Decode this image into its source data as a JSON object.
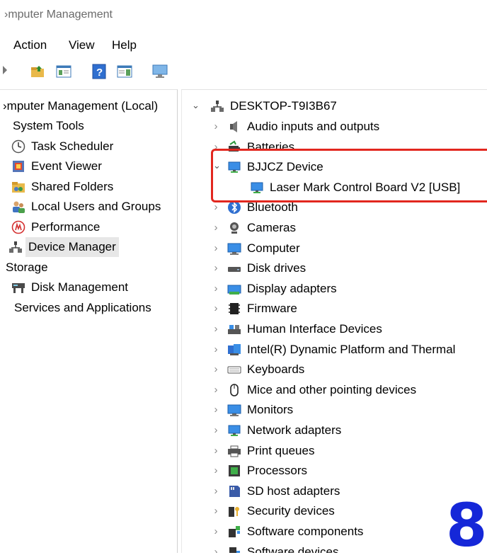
{
  "window": {
    "title": "›mputer Management"
  },
  "menu": {
    "items": [
      "Action",
      "View",
      "Help"
    ]
  },
  "left_tree": {
    "root": "›mputer Management (Local)",
    "system_tools": "System Tools",
    "task_scheduler": "Task Scheduler",
    "event_viewer": "Event Viewer",
    "shared_folders": "Shared Folders",
    "local_users": "Local Users and Groups",
    "performance": "Performance",
    "device_manager": "Device Manager",
    "storage": "Storage",
    "disk_management": "Disk Management",
    "services": "Services and Applications"
  },
  "device_tree": {
    "computer_name": "DESKTOP-T9I3B67",
    "categories": [
      {
        "label": "Audio inputs and outputs",
        "icon": "speaker-icon"
      },
      {
        "label": "Batteries",
        "icon": "battery-icon"
      },
      {
        "label": "BJJCZ Device",
        "icon": "monitor-network-icon",
        "expanded": true
      },
      {
        "label": "Laser Mark Control Board V2 [USB]",
        "icon": "monitor-network-icon",
        "child": true
      },
      {
        "label": "Bluetooth",
        "icon": "bluetooth-icon"
      },
      {
        "label": "Cameras",
        "icon": "camera-icon"
      },
      {
        "label": "Computer",
        "icon": "computer-icon"
      },
      {
        "label": "Disk drives",
        "icon": "disk-drive-icon"
      },
      {
        "label": "Display adapters",
        "icon": "display-adapter-icon"
      },
      {
        "label": "Firmware",
        "icon": "firmware-chip-icon"
      },
      {
        "label": "Human Interface Devices",
        "icon": "hid-icon"
      },
      {
        "label": "Intel(R) Dynamic Platform and Thermal",
        "icon": "intel-icon"
      },
      {
        "label": "Keyboards",
        "icon": "keyboard-icon"
      },
      {
        "label": "Mice and other pointing devices",
        "icon": "mouse-icon"
      },
      {
        "label": "Monitors",
        "icon": "monitor-icon"
      },
      {
        "label": "Network adapters",
        "icon": "network-adapter-icon"
      },
      {
        "label": "Print queues",
        "icon": "printer-icon"
      },
      {
        "label": "Processors",
        "icon": "processor-icon"
      },
      {
        "label": "SD host adapters",
        "icon": "sd-card-icon"
      },
      {
        "label": "Security devices",
        "icon": "security-key-icon"
      },
      {
        "label": "Software components",
        "icon": "software-component-icon"
      },
      {
        "label": "Software devices",
        "icon": "software-device-icon"
      }
    ]
  },
  "annotation": {
    "number": "8"
  },
  "colors": {
    "highlight": "#e2271f",
    "annotation": "#1527d8",
    "selection": "#e7e7e7"
  }
}
